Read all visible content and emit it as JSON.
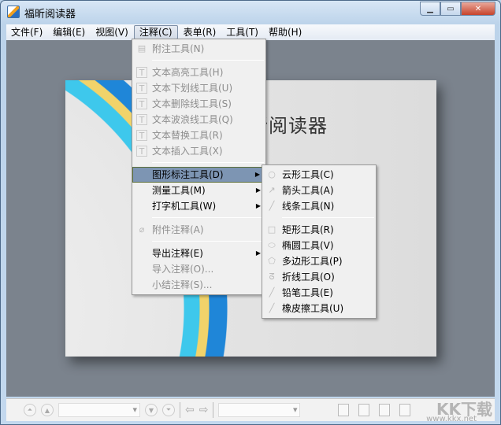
{
  "window": {
    "title": "福昕阅读器",
    "controls": [
      "minimize",
      "maximize",
      "close"
    ]
  },
  "menubar": [
    {
      "label": "文件(F)"
    },
    {
      "label": "编辑(E)"
    },
    {
      "label": "视图(V)"
    },
    {
      "label": "注释(C)",
      "open": true
    },
    {
      "label": "表单(R)"
    },
    {
      "label": "工具(T)"
    },
    {
      "label": "帮助(H)"
    }
  ],
  "page": {
    "title": "福昕阅读器"
  },
  "annot_menu": {
    "items": [
      {
        "label": "附注工具(N)",
        "icon": "note-icon",
        "disabled": true
      },
      {
        "sep": true
      },
      {
        "label": "文本高亮工具(H)",
        "icon": "text-highlight-icon",
        "disabled": true
      },
      {
        "label": "文本下划线工具(U)",
        "icon": "text-underline-icon",
        "disabled": true
      },
      {
        "label": "文本删除线工具(S)",
        "icon": "text-strikeout-icon",
        "disabled": true
      },
      {
        "label": "文本波浪线工具(Q)",
        "icon": "text-squiggly-icon",
        "disabled": true
      },
      {
        "label": "文本替换工具(R)",
        "icon": "text-replace-icon",
        "disabled": true
      },
      {
        "label": "文本插入工具(X)",
        "icon": "text-insert-icon",
        "disabled": true
      },
      {
        "sep": true
      },
      {
        "label": "图形标注工具(D)",
        "submenu": true,
        "highlighted": true
      },
      {
        "label": "测量工具(M)",
        "submenu": true
      },
      {
        "label": "打字机工具(W)",
        "submenu": true
      },
      {
        "sep": true
      },
      {
        "label": "附件注释(A)",
        "icon": "paperclip-icon",
        "disabled": true
      },
      {
        "sep": true
      },
      {
        "label": "导出注释(E)",
        "submenu": true
      },
      {
        "label": "导入注释(O)...",
        "disabled": true
      },
      {
        "label": "小结注释(S)...",
        "disabled": true
      }
    ]
  },
  "drawing_submenu": {
    "items": [
      {
        "label": "云形工具(C)",
        "icon": "cloud-icon"
      },
      {
        "label": "箭头工具(A)",
        "icon": "arrow-icon"
      },
      {
        "label": "线条工具(N)",
        "icon": "line-icon"
      },
      {
        "sep": true
      },
      {
        "label": "矩形工具(R)",
        "icon": "rectangle-icon"
      },
      {
        "label": "椭圆工具(V)",
        "icon": "ellipse-icon"
      },
      {
        "label": "多边形工具(P)",
        "icon": "polygon-icon"
      },
      {
        "label": "折线工具(O)",
        "icon": "polyline-icon"
      },
      {
        "label": "铅笔工具(E)",
        "icon": "pencil-icon"
      },
      {
        "label": "橡皮擦工具(U)",
        "icon": "eraser-icon"
      }
    ]
  },
  "watermark": {
    "logo": "KK下载",
    "url": "www.kkx.net"
  }
}
